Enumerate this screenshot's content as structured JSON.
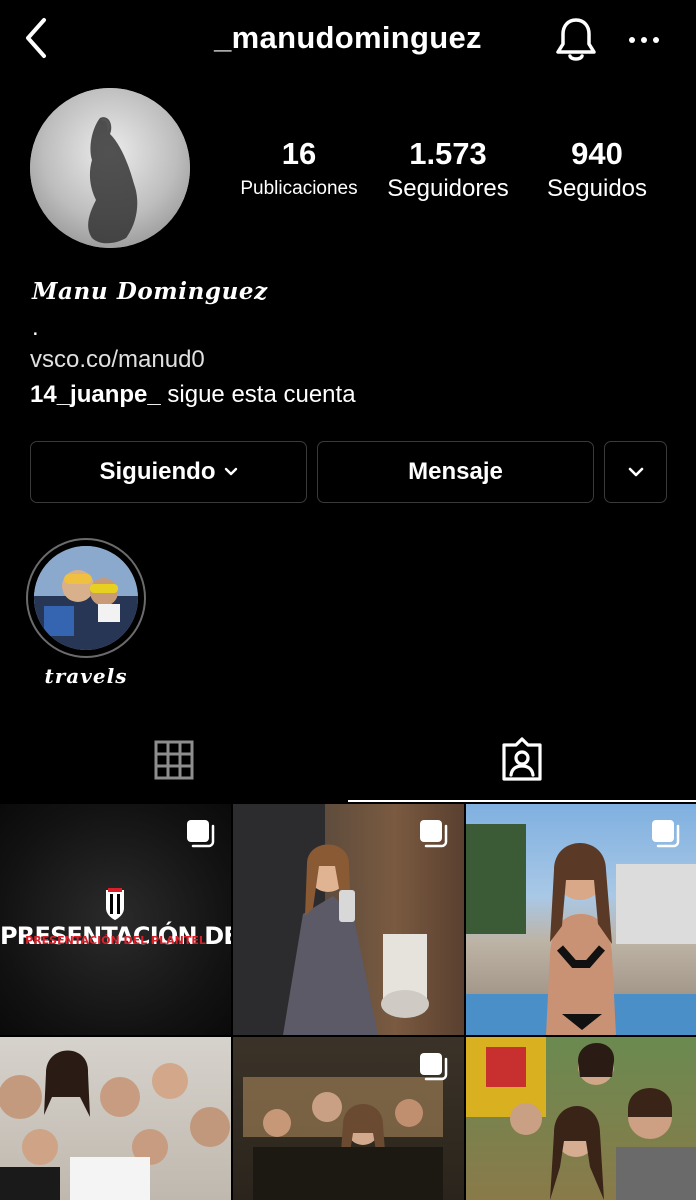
{
  "header": {
    "username": "_manudominguez",
    "back_icon": "chevron-left-icon",
    "bell_icon": "bell-icon",
    "more_icon": "more-horizontal-icon"
  },
  "profile": {
    "stats": {
      "posts": {
        "value": "16",
        "label": "Publicaciones"
      },
      "followers": {
        "value": "1.573",
        "label": "Seguidores"
      },
      "following": {
        "value": "940",
        "label": "Seguidos"
      }
    },
    "display_name": "𝑴𝒂𝒏𝒖 𝑫𝒐𝒎𝒊𝒏𝒈𝒖𝒆𝒛",
    "bio_line": ".",
    "website": "vsco.co/manud0",
    "followed_by_user": "14_juanpe_",
    "followed_by_suffix": " sigue esta cuenta"
  },
  "actions": {
    "following_label": "Siguiendo",
    "message_label": "Mensaje"
  },
  "highlights": [
    {
      "label": "𝒕𝒓𝒂𝒗𝒆𝒍𝒔"
    }
  ],
  "tabs": {
    "grid_icon": "grid-icon",
    "tagged_icon": "tagged-person-icon",
    "active": "tagged"
  },
  "posts": {
    "first_caption": "PRESENTACIÓN DEL PLANTEL",
    "first_caption_overlay": "PRESENTACIÓN DEL PLANTEL"
  },
  "colors": {
    "background": "#000000",
    "border": "#3a3a3a",
    "text": "#ffffff"
  }
}
